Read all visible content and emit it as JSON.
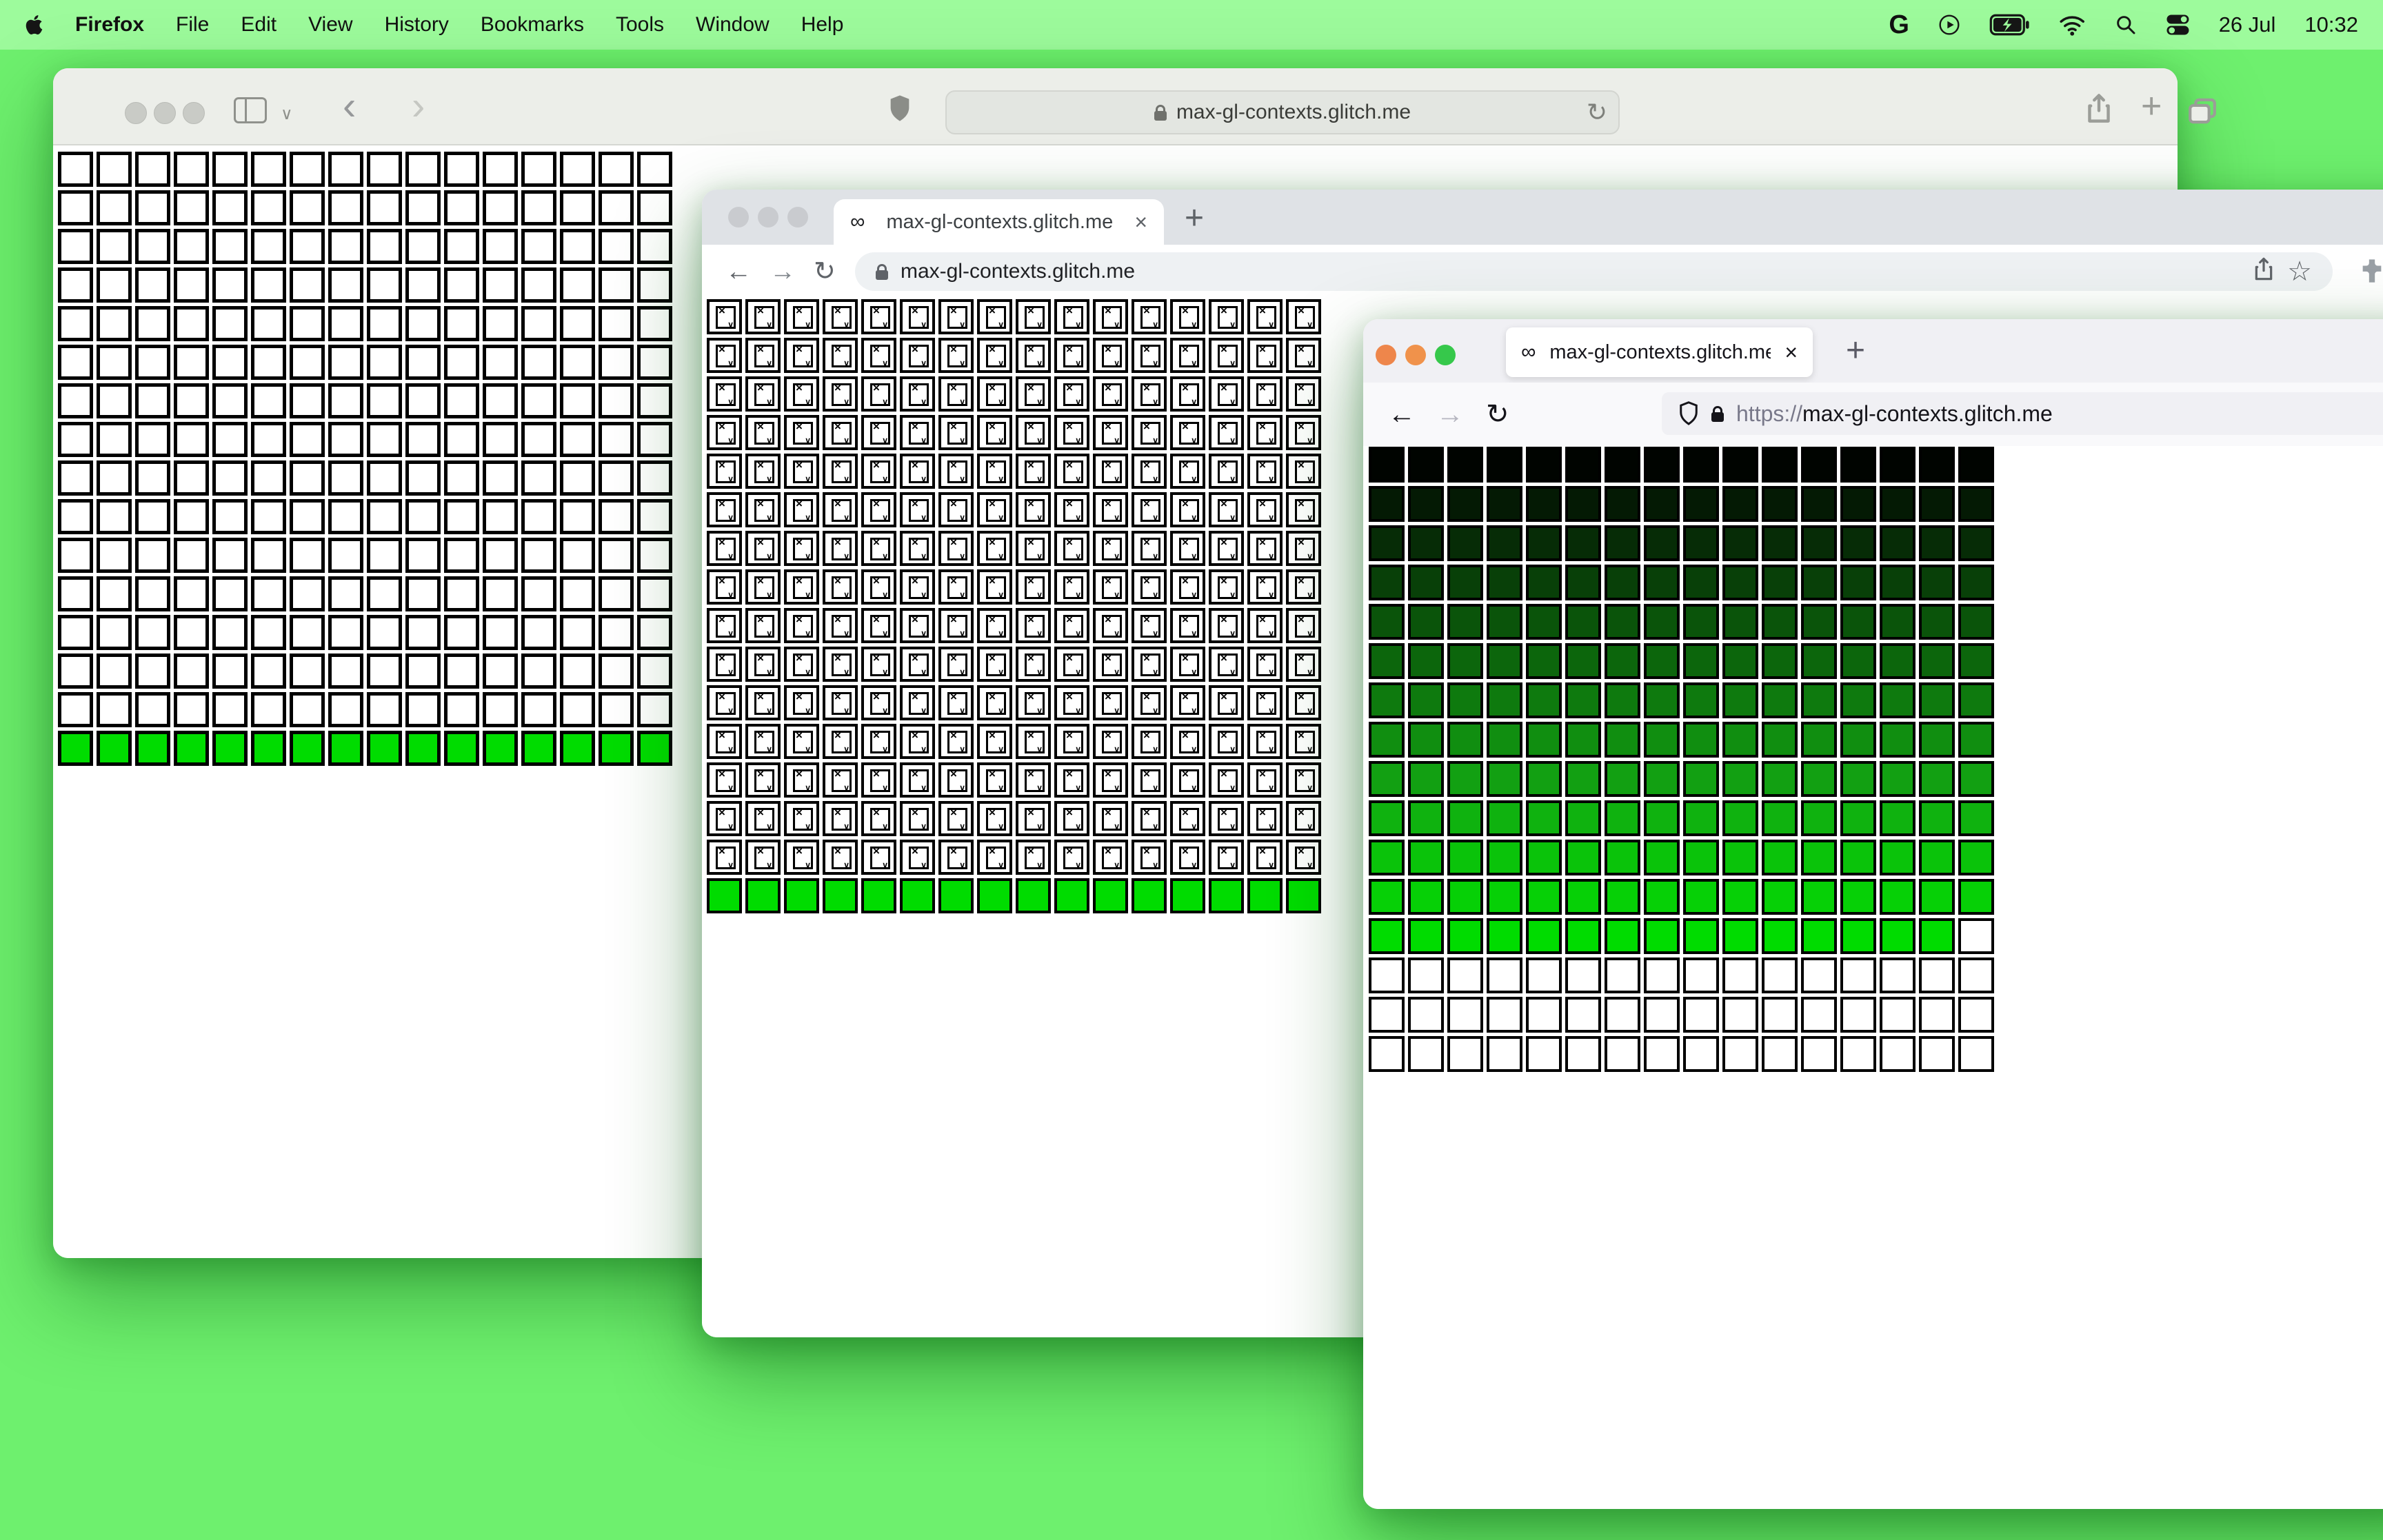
{
  "menu_bar": {
    "app_name": "Firefox",
    "items": [
      "File",
      "Edit",
      "View",
      "History",
      "Bookmarks",
      "Tools",
      "Window",
      "Help"
    ],
    "date": "26 Jul",
    "time": "10:32"
  },
  "glyphs": {
    "google_g": "G",
    "infinity": "∞",
    "close": "×",
    "plus": "+",
    "back": "←",
    "forward": "→",
    "reload": "↻",
    "back_thin": "‹",
    "forward_thin": "›",
    "star": "☆",
    "chevron_down": "∨"
  },
  "safari_window": {
    "url": "max-gl-contexts.glitch.me"
  },
  "chrome_window": {
    "tab_title": "max-gl-contexts.glitch.me",
    "url": "max-gl-contexts.glitch.me"
  },
  "firefox_window": {
    "tab_title": "max-gl-contexts.glitch.me/",
    "url_scheme": "https://",
    "url_host": "max-gl-contexts.glitch.me"
  },
  "colors": {
    "desktop": "#6ef06e",
    "menubar": "#9dfb9c",
    "canvas_green": "#00dc00",
    "traffic_red": "#ee864b",
    "traffic_yellow": "#f0924b",
    "traffic_green": "#36c84b"
  },
  "grids": {
    "safari": {
      "cols": 16,
      "rows": 16,
      "cell": 51,
      "gap": 5,
      "border": 5,
      "pattern": "white-rows-then-green",
      "green_row_index": 15,
      "green": "#00dc00",
      "white": "#ffffff",
      "border_color": "#000000"
    },
    "chrome": {
      "cols": 16,
      "rows": 16,
      "cell": 51,
      "gap": 5,
      "border": 4,
      "pattern": "broken-rows-then-green",
      "green_row_index": 15,
      "green": "#00dc00",
      "white": "#ffffff",
      "border_color": "#000000"
    },
    "firefox": {
      "cols": 16,
      "rows": 16,
      "cell": 52,
      "gap": 5,
      "border": 4,
      "pattern": "gradient",
      "row_colors": [
        "#000400",
        "#041a04",
        "#062c06",
        "#084008",
        "#0a540a",
        "#0c660c",
        "#0e7a0e",
        "#108e10",
        "#12a012",
        "#0fb20f",
        "#0ac30a",
        "#06d006"
      ],
      "bright_row_index": 12,
      "bright_row_color": "#00dc00",
      "bright_row_white_last_cell": true,
      "white": "#ffffff",
      "border_color": "#000000"
    }
  }
}
